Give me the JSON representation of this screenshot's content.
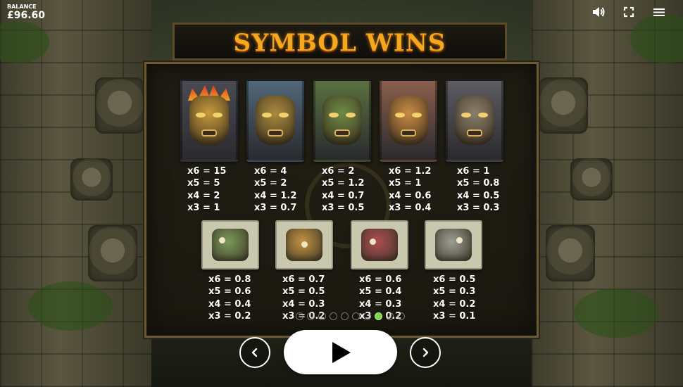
{
  "hud": {
    "balance_label": "BALANCE",
    "balance_value": "£96.60",
    "icons": [
      "speaker-icon",
      "fullscreen-icon",
      "menu-icon"
    ]
  },
  "title": "SYMBOL WINS",
  "paytable": {
    "premium_symbols": [
      {
        "name": "crowned-mask",
        "colors": {
          "bg": "#4a4a52",
          "face": "#c79a3c"
        },
        "pays": [
          "x6 = 15",
          "x5 = 5",
          "x4 = 2",
          "x3 = 1"
        ]
      },
      {
        "name": "blue-mask",
        "colors": {
          "bg": "#51677a",
          "face": "#a98a3e"
        },
        "pays": [
          "x6 = 4",
          "x5 = 2",
          "x4 = 1.2",
          "x3 = 0.7"
        ]
      },
      {
        "name": "green-mask",
        "colors": {
          "bg": "#5a7040",
          "face": "#6f8a45"
        },
        "pays": [
          "x6 = 2",
          "x5 = 1.2",
          "x4 = 0.7",
          "x3 = 0.5"
        ]
      },
      {
        "name": "orange-mask",
        "colors": {
          "bg": "#8a5f4c",
          "face": "#c98b45"
        },
        "pays": [
          "x6 = 1.2",
          "x5 = 1",
          "x4 = 0.6",
          "x3 = 0.4"
        ]
      },
      {
        "name": "stone-mask",
        "colors": {
          "bg": "#5c5c62",
          "face": "#8a7f6c"
        },
        "pays": [
          "x6 = 1",
          "x5 = 0.8",
          "x4 = 0.5",
          "x3 = 0.3"
        ]
      }
    ],
    "low_symbols": [
      {
        "name": "green-glyph",
        "colors": {
          "bg": "#c9c7ae",
          "glyph": "#7c9a58"
        },
        "pays": [
          "x6 = 0.8",
          "x5 = 0.6",
          "x4 = 0.4",
          "x3 = 0.2"
        ]
      },
      {
        "name": "gold-glyph",
        "colors": {
          "bg": "#c9c7ae",
          "glyph": "#c4923f"
        },
        "pays": [
          "x6 = 0.7",
          "x5 = 0.5",
          "x4 = 0.3",
          "x3 = 0.2"
        ]
      },
      {
        "name": "red-glyph",
        "colors": {
          "bg": "#c9c7ae",
          "glyph": "#b04b52"
        },
        "pays": [
          "x6 = 0.6",
          "x5 = 0.4",
          "x4 = 0.3",
          "x3 = 0.2"
        ]
      },
      {
        "name": "grey-glyph",
        "colors": {
          "bg": "#c9c7ae",
          "glyph": "#9d9d92"
        },
        "pays": [
          "x6 = 0.5",
          "x5 = 0.3",
          "x4 = 0.2",
          "x3 = 0.1"
        ]
      }
    ]
  },
  "pagination": {
    "total": 10,
    "current": 8
  },
  "controls": {
    "prev_icon": "chevron-left-icon",
    "play_icon": "play-icon",
    "next_icon": "chevron-right-icon"
  }
}
